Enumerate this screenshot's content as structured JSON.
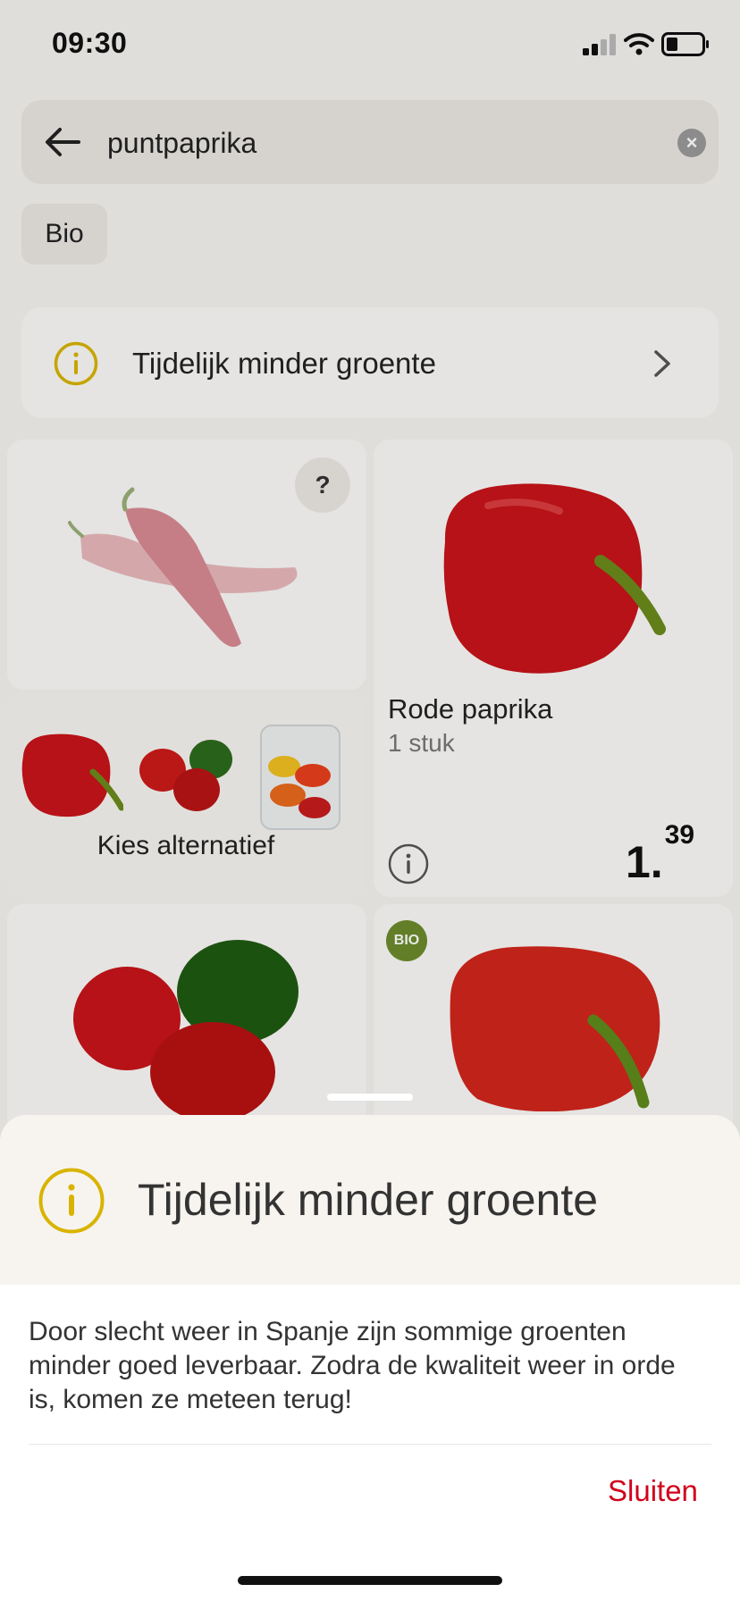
{
  "status_bar": {
    "time": "09:30"
  },
  "search": {
    "query": "puntpaprika"
  },
  "filters": {
    "chip_label": "Bio"
  },
  "banner": {
    "text": "Tijdelijk minder groente"
  },
  "products": [
    {
      "help_label": "?",
      "alternative_label": "Kies alternatief"
    },
    {
      "name": "Rode paprika",
      "quantity": "1 stuk",
      "price_whole": "1.",
      "price_cents": "39"
    },
    {},
    {
      "badge": "BIO"
    }
  ],
  "sheet": {
    "title": "Tijdelijk minder groente",
    "body": "Door slecht weer in Spanje zijn sommige groenten minder goed leverbaar. Zodra de kwaliteit weer in orde is, komen ze meteen terug!",
    "close_label": "Sluiten"
  },
  "colors": {
    "accent_red": "#d0021b",
    "info_yellow": "#d8b400",
    "bio_green": "#6c8c2c"
  }
}
